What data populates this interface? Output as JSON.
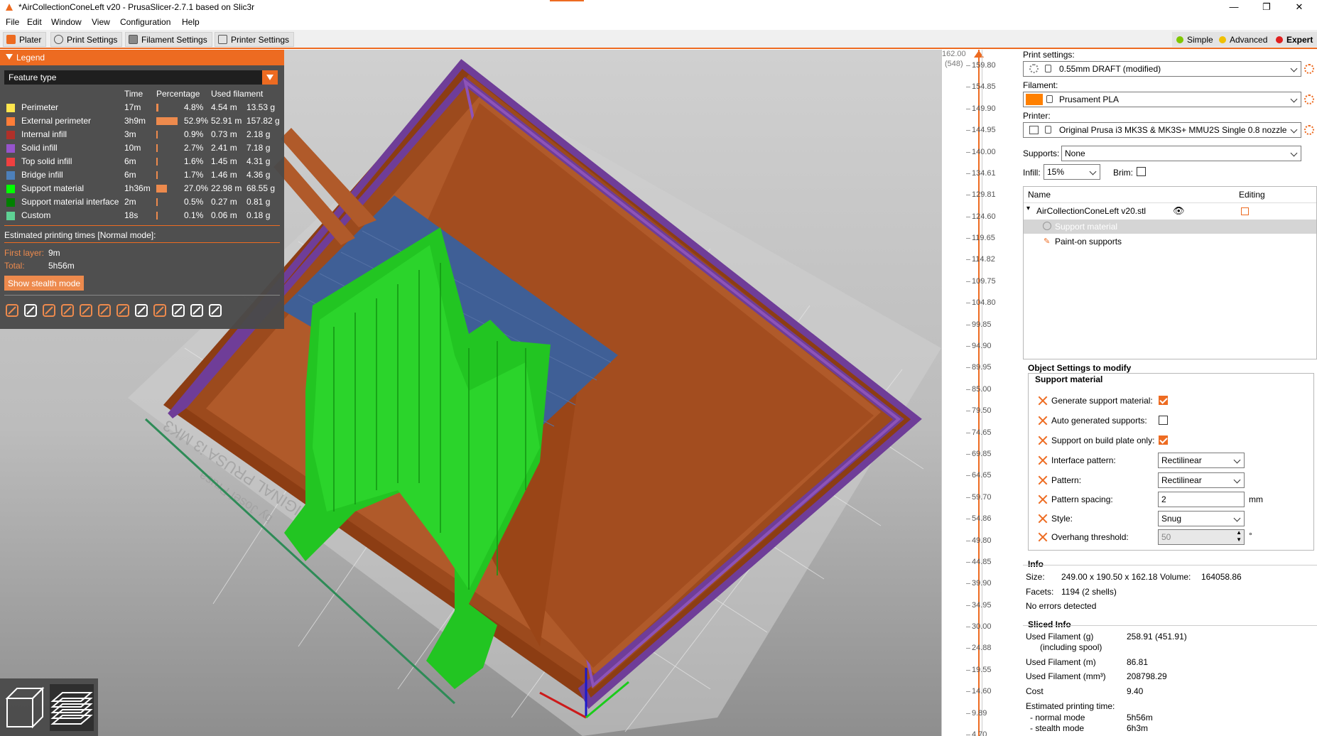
{
  "window": {
    "title": "*AirCollectionConeLeft v20 - PrusaSlicer-2.7.1 based on Slic3r",
    "minimize": "—",
    "maximize": "❐",
    "close": "✕"
  },
  "menu": [
    "File",
    "Edit",
    "Window",
    "View",
    "Configuration",
    "Help"
  ],
  "tabs": [
    "Plater",
    "Print Settings",
    "Filament Settings",
    "Printer Settings"
  ],
  "modes": [
    {
      "label": "Simple",
      "color": "#7fc700"
    },
    {
      "label": "Advanced",
      "color": "#f0c000"
    },
    {
      "label": "Expert",
      "color": "#e02020"
    }
  ],
  "legend": {
    "title": "Legend",
    "view_type": "Feature type",
    "columns": {
      "time": "Time",
      "percentage": "Percentage",
      "filament": "Used filament"
    },
    "features": [
      {
        "name": "Perimeter",
        "color": "#ffe64d",
        "time": "17m",
        "pct": "4.8%",
        "pct_value": 4.8,
        "length": "4.54 m",
        "weight": "13.53 g"
      },
      {
        "name": "External perimeter",
        "color": "#ff7d38",
        "time": "3h9m",
        "pct": "52.9%",
        "pct_value": 52.9,
        "length": "52.91 m",
        "weight": "157.82 g"
      },
      {
        "name": "Internal infill",
        "color": "#b03029",
        "time": "3m",
        "pct": "0.9%",
        "pct_value": 0.9,
        "length": "0.73 m",
        "weight": "2.18 g"
      },
      {
        "name": "Solid infill",
        "color": "#9654cc",
        "time": "10m",
        "pct": "2.7%",
        "pct_value": 2.7,
        "length": "2.41 m",
        "weight": "7.18 g"
      },
      {
        "name": "Top solid infill",
        "color": "#f04040",
        "time": "6m",
        "pct": "1.6%",
        "pct_value": 1.6,
        "length": "1.45 m",
        "weight": "4.31 g"
      },
      {
        "name": "Bridge infill",
        "color": "#4d80ba",
        "time": "6m",
        "pct": "1.7%",
        "pct_value": 1.7,
        "length": "1.46 m",
        "weight": "4.36 g"
      },
      {
        "name": "Support material",
        "color": "#00ff00",
        "time": "1h36m",
        "pct": "27.0%",
        "pct_value": 27.0,
        "length": "22.98 m",
        "weight": "68.55 g"
      },
      {
        "name": "Support material interface",
        "color": "#008000",
        "time": "2m",
        "pct": "0.5%",
        "pct_value": 0.5,
        "length": "0.27 m",
        "weight": "0.81 g"
      },
      {
        "name": "Custom",
        "color": "#5ed194",
        "time": "18s",
        "pct": "0.1%",
        "pct_value": 0.1,
        "length": "0.06 m",
        "weight": "0.18 g"
      }
    ],
    "estimated_label": "Estimated printing times [Normal mode]:",
    "first_layer_label": "First layer:",
    "first_layer_value": "9m",
    "total_label": "Total:",
    "total_value": "5h56m",
    "stealth_button": "Show stealth mode",
    "tools": [
      "travel-icon",
      "wipe-icon",
      "retractions-icon",
      "deretractions-icon",
      "seams-icon",
      "tool-changes-icon",
      "color-changes-icon",
      "pause-prints-icon",
      "custom-gcodes-icon",
      "center-of-gravity-icon",
      "shells-icon",
      "tool-marker-icon"
    ]
  },
  "bed_text": [
    "ORIGINAL PRUSA i3 MK3",
    "by Josef Prusa"
  ],
  "slider": {
    "top_value": "162.00",
    "top_layer": "(548)",
    "ticks": [
      "159.80",
      "154.85",
      "149.90",
      "144.95",
      "140.00",
      "134.61",
      "129.81",
      "124.60",
      "119.65",
      "114.82",
      "109.75",
      "104.80",
      "99.85",
      "94.90",
      "89.95",
      "85.00",
      "79.50",
      "74.65",
      "69.85",
      "64.65",
      "59.70",
      "54.86",
      "49.80",
      "44.85",
      "39.90",
      "34.95",
      "30.00",
      "24.88",
      "19.55",
      "14.60",
      "9.89",
      "4.70"
    ]
  },
  "sidebar": {
    "print_settings_label": "Print settings:",
    "print_settings_value": "0.55mm DRAFT (modified)",
    "filament_label": "Filament:",
    "filament_value": "Prusament PLA",
    "filament_color": "#ff8000",
    "printer_label": "Printer:",
    "printer_value": "Original Prusa i3 MK3S & MK3S+ MMU2S Single 0.8 nozzle",
    "supports_label": "Supports:",
    "supports_value": "None",
    "infill_label": "Infill:",
    "infill_value": "15%",
    "brim_label": "Brim:",
    "object_list": {
      "col_name": "Name",
      "col_editing": "Editing",
      "object": "AirCollectionConeLeft v20.stl",
      "children": [
        "Support material",
        "Paint-on supports"
      ]
    },
    "object_settings": {
      "title": "Object Settings to modify",
      "group": "Support material",
      "options": [
        {
          "label": "Generate support material:",
          "type": "check",
          "checked": true
        },
        {
          "label": "Auto generated supports:",
          "type": "check",
          "checked": false
        },
        {
          "label": "Support on build plate only:",
          "type": "check",
          "checked": true
        },
        {
          "label": "Interface pattern:",
          "type": "combo",
          "value": "Rectilinear"
        },
        {
          "label": "Pattern:",
          "type": "combo",
          "value": "Rectilinear"
        },
        {
          "label": "Pattern spacing:",
          "type": "text",
          "value": "2",
          "unit": "mm"
        },
        {
          "label": "Style:",
          "type": "combo",
          "value": "Snug"
        },
        {
          "label": "Overhang threshold:",
          "type": "spin",
          "value": "50",
          "unit": "°"
        }
      ]
    },
    "info": {
      "title": "Info",
      "size_label": "Size:",
      "size_value": "249.00 x 190.50 x 162.18",
      "volume_label": "Volume:",
      "volume_value": "164058.86",
      "facets_label": "Facets:",
      "facets_value": "1194 (2 shells)",
      "errors": "No errors detected"
    },
    "sliced": {
      "title": "Sliced Info",
      "used_g_label": "Used Filament (g)",
      "used_g_sub": "(including spool)",
      "used_g_value": "258.91 (451.91)",
      "used_m_label": "Used Filament (m)",
      "used_m_value": "86.81",
      "used_mm3_label": "Used Filament (mm³)",
      "used_mm3_value": "208798.29",
      "cost_label": "Cost",
      "cost_value": "9.40",
      "est_label": "Estimated printing time:",
      "normal_label": "- normal mode",
      "normal_value": "5h56m",
      "stealth_label": "- stealth mode",
      "stealth_value": "6h3m"
    }
  }
}
